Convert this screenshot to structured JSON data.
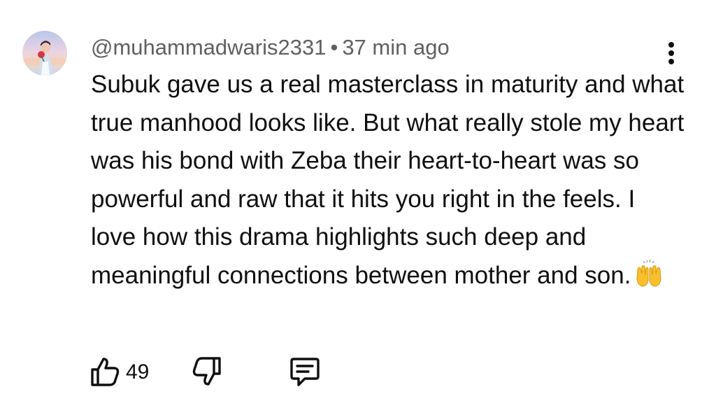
{
  "comment": {
    "author": "@muhammadwaris2331",
    "separator": "•",
    "time": "37 min ago",
    "text": "Subuk gave us a real masterclass in maturity and what true manhood looks like. But what really stole my heart was his bond with Zeba their heart-to-heart was so powerful and raw that it hits you right in the feels. I love how this drama highlights such deep and meaningful connections between mother and son.",
    "emoji": "raising-hands-emoji",
    "like_count": "49"
  },
  "icons": {
    "like": "thumbs-up-icon",
    "dislike": "thumbs-down-icon",
    "reply": "comment-icon",
    "menu": "more-vertical-icon"
  },
  "colors": {
    "text": "#0f0f0f",
    "meta": "#606060",
    "emoji": "#f7c02c"
  }
}
